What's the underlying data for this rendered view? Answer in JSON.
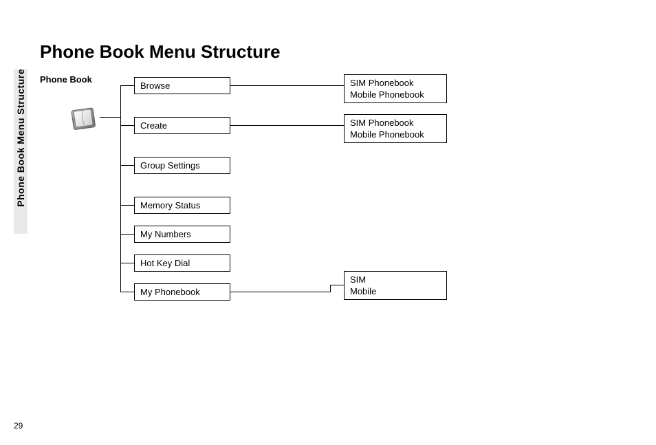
{
  "side_tab": "Phone Book Menu Structure",
  "page_title": "Phone Book Menu Structure",
  "root_label": "Phone Book",
  "page_number": "29",
  "level1": {
    "browse": "Browse",
    "create": "Create",
    "group_settings": "Group Settings",
    "memory_status": "Memory Status",
    "my_numbers": "My Numbers",
    "hot_key_dial": "Hot Key Dial",
    "my_phonebook": "My Phonebook"
  },
  "level2": {
    "browse": {
      "line1": "SIM Phonebook",
      "line2": "Mobile Phonebook"
    },
    "create": {
      "line1": "SIM Phonebook",
      "line2": "Mobile Phonebook"
    },
    "my_phonebook": {
      "line1": "SIM",
      "line2": "Mobile"
    }
  }
}
